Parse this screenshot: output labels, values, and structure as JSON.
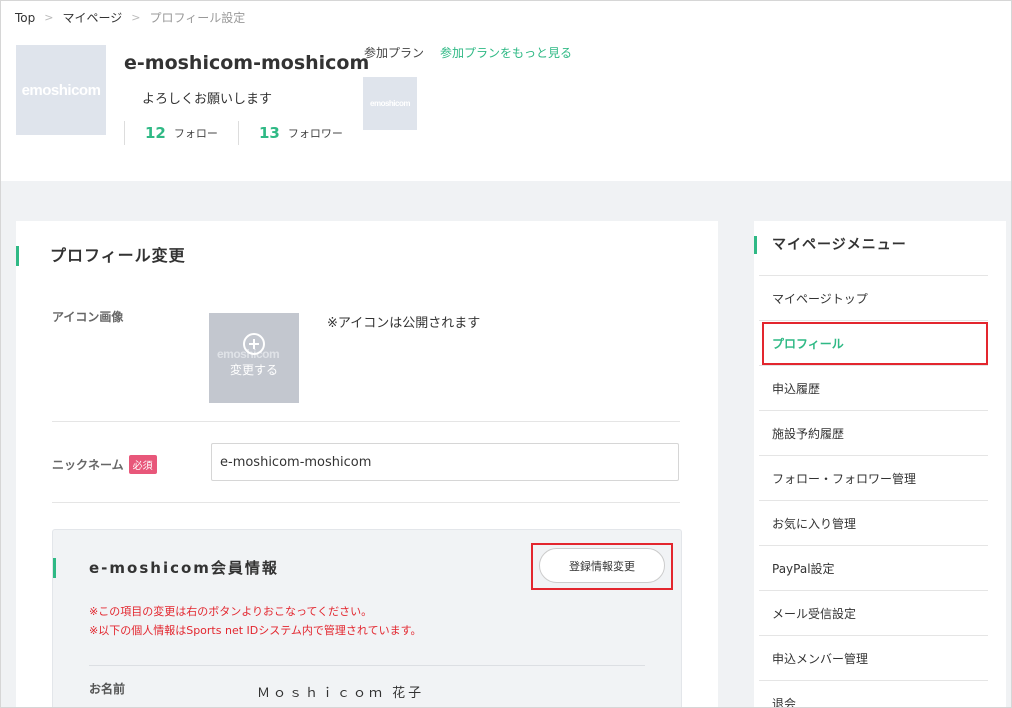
{
  "breadcrumb": {
    "top": "Top",
    "mypage": "マイページ",
    "current": "プロフィール設定",
    "sep": ">"
  },
  "user": {
    "avatar_logo": "emoshicom",
    "name": "e-moshicom-moshicom",
    "bio": "よろしくお願いします",
    "follow_count": "12",
    "follow_label": "フォロー",
    "follower_count": "13",
    "follower_label": "フォロワー"
  },
  "plan": {
    "label": "参加プラン",
    "link": "参加プランをもっと見る",
    "thumb_logo": "emoshicom"
  },
  "profile": {
    "title": "プロフィール変更",
    "icon_label": "アイコン画像",
    "icon_change": "変更する",
    "icon_logo": "emoshicom",
    "icon_note": "※アイコンは公開されます",
    "nickname_label": "ニックネーム",
    "required": "必須",
    "nickname_value": "e-moshicom-moshicom"
  },
  "member": {
    "title": "e-moshicom会員情報",
    "edit_button": "登録情報変更",
    "warning1": "※この項目の変更は右のボタンよりおこなってください。",
    "warning2": "※以下の個人情報はSports net IDシステム内で管理されています。",
    "name_label": "お名前",
    "name_value": "Ｍｏｓｈｉｃｏｍ 花子"
  },
  "sidemenu": {
    "title": "マイページメニュー",
    "items": [
      {
        "label": "マイページトップ"
      },
      {
        "label": "プロフィール"
      },
      {
        "label": "申込履歴"
      },
      {
        "label": "施設予約履歴"
      },
      {
        "label": "フォロー・フォロワー管理"
      },
      {
        "label": "お気に入り管理"
      },
      {
        "label": "PayPal設定"
      },
      {
        "label": "メール受信設定"
      },
      {
        "label": "申込メンバー管理"
      },
      {
        "label": "退会"
      }
    ]
  },
  "colors": {
    "accent": "#2fb985",
    "warning": "#e3262e",
    "badge": "#e8577a"
  }
}
